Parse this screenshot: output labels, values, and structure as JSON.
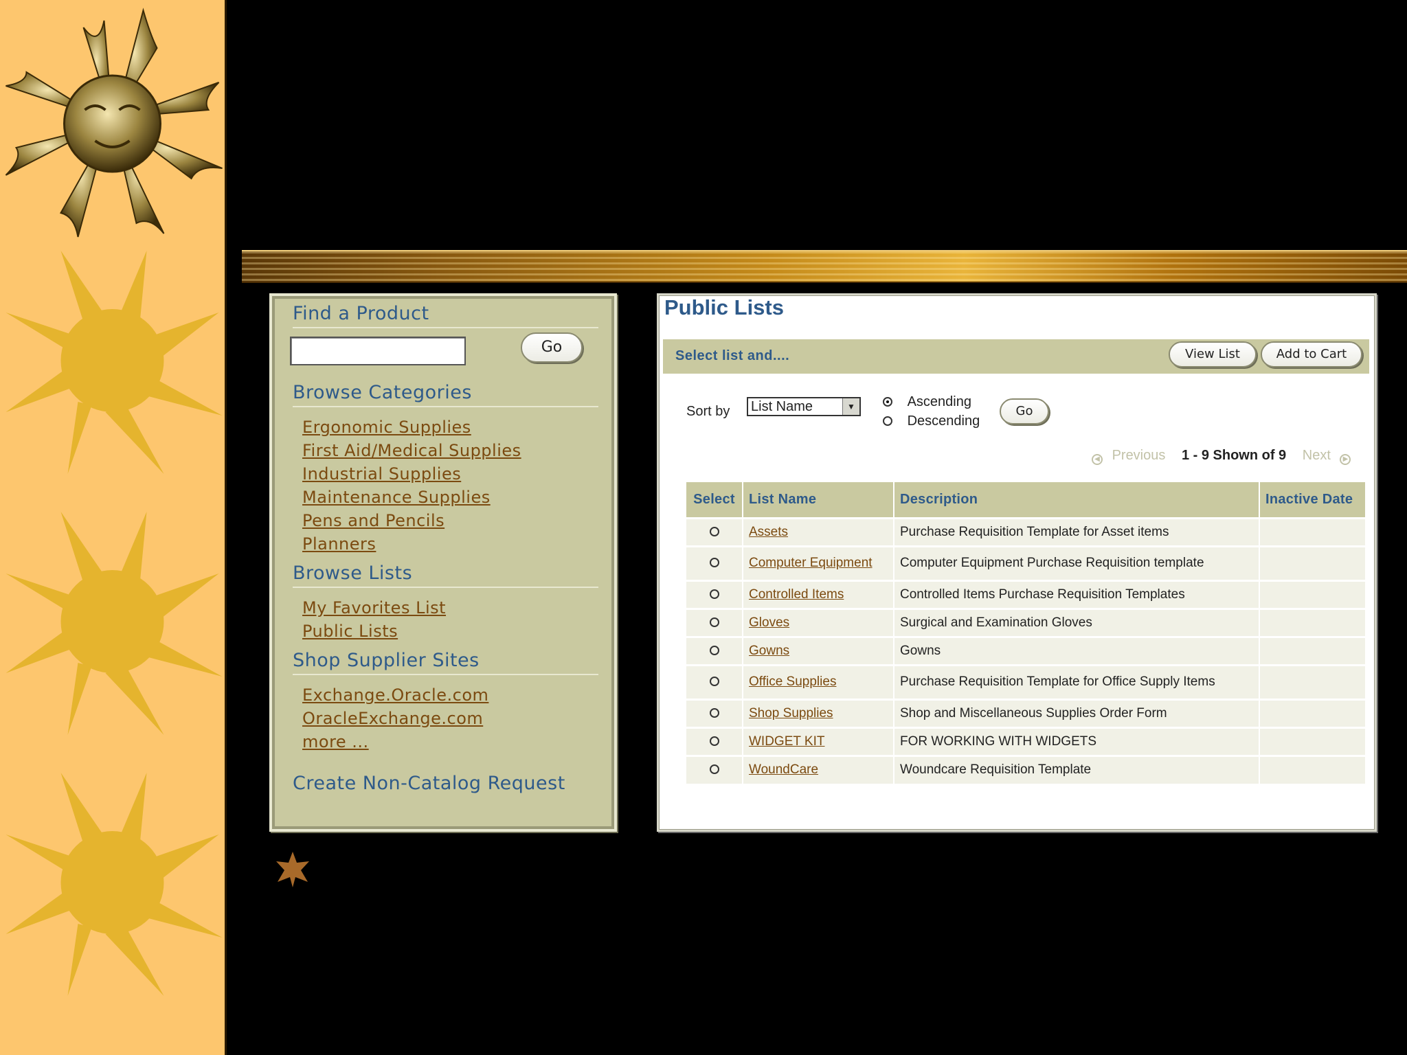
{
  "colors": {
    "strip": "#fdc66e",
    "panel": "#c9c9a0",
    "heading_blue": "#2e5a8a",
    "link_brown": "#7b4a10",
    "row_bg": "#f1f1e6"
  },
  "decor": {
    "sun_icons": [
      "sun-face-icon",
      "sun-icon",
      "sun-icon",
      "sun-icon"
    ],
    "bullet": "star-bullet-icon"
  },
  "find": {
    "title": "Find a Product",
    "search_value": "",
    "go_label": "Go"
  },
  "browse_categories": {
    "title": "Browse Categories",
    "items": [
      "Ergonomic Supplies",
      "First Aid/Medical Supplies",
      "Industrial Supplies",
      "Maintenance Supplies",
      "Pens and Pencils",
      "Planners"
    ]
  },
  "browse_lists": {
    "title": "Browse Lists",
    "items": [
      "My Favorites List",
      "Public Lists"
    ]
  },
  "supplier_sites": {
    "title": "Shop Supplier Sites",
    "items": [
      "Exchange.Oracle.com",
      "OracleExchange.com",
      "more ..."
    ]
  },
  "create_request": "Create Non-Catalog Request",
  "public_lists": {
    "title": "Public Lists",
    "action_label": "Select list and....",
    "view_list": "View List",
    "add_to_cart": "Add to Cart",
    "sort": {
      "label": "Sort by",
      "selected": "List Name",
      "ascending": "Ascending",
      "descending": "Descending",
      "selected_order": "Ascending",
      "go_label": "Go"
    },
    "pager": {
      "previous": "Previous",
      "range": "1 - 9 Shown of 9",
      "next": "Next"
    },
    "columns": [
      "Select",
      "List Name",
      "Description",
      "Inactive Date"
    ],
    "rows": [
      {
        "name": "Assets",
        "description": "Purchase Requisition Template for Asset items",
        "inactive": ""
      },
      {
        "name": "Computer Equipment",
        "description": "Computer Equipment Purchase Requisition template",
        "inactive": ""
      },
      {
        "name": "Controlled Items",
        "description": "Controlled Items Purchase Requisition Templates",
        "inactive": ""
      },
      {
        "name": "Gloves",
        "description": "Surgical and Examination Gloves",
        "inactive": ""
      },
      {
        "name": "Gowns",
        "description": "Gowns",
        "inactive": ""
      },
      {
        "name": "Office Supplies",
        "description": "Purchase Requisition Template for Office Supply Items",
        "inactive": ""
      },
      {
        "name": "Shop Supplies",
        "description": "Shop and Miscellaneous Supplies Order Form",
        "inactive": ""
      },
      {
        "name": "WIDGET KIT",
        "description": "FOR WORKING WITH WIDGETS",
        "inactive": ""
      },
      {
        "name": "WoundCare",
        "description": "Woundcare Requisition Template",
        "inactive": ""
      }
    ]
  }
}
